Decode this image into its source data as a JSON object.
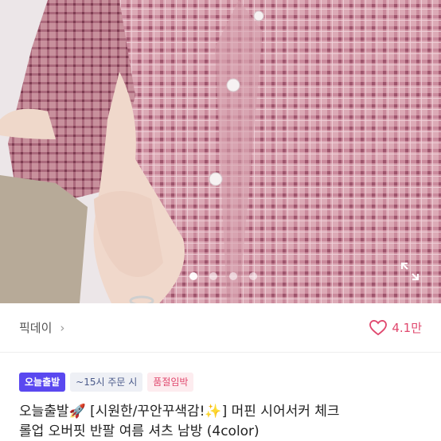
{
  "product_image": {
    "description_icon": "pink-gingham-shirt-photo",
    "colors": {
      "shirt": "#d9a6b2",
      "check": "#b06a80",
      "background": "#e9e3e6",
      "skin": "#f1d9cc",
      "pants": "#b8ab9a"
    },
    "carousel": {
      "total": 4,
      "active_index": 0
    },
    "expand_icon": "expand-icon"
  },
  "store": {
    "name": "픽데이",
    "chevron": "›",
    "like_icon": "heart-outline-icon",
    "like_count": "4.1만"
  },
  "tags": {
    "today_shipping": "오늘출발",
    "deadline": "~15시 주문 시",
    "soldout_warning": "품절임박"
  },
  "title": {
    "line1": "오늘출발🚀 [시원한/꾸안꾸색감!✨] 머핀 시어서커 체크",
    "line2": "롤업 오버핏 반팔 여름 셔츠 남방 (4color)"
  },
  "accent_colors": {
    "brand": "#5a48f0",
    "like": "#e0486e"
  }
}
